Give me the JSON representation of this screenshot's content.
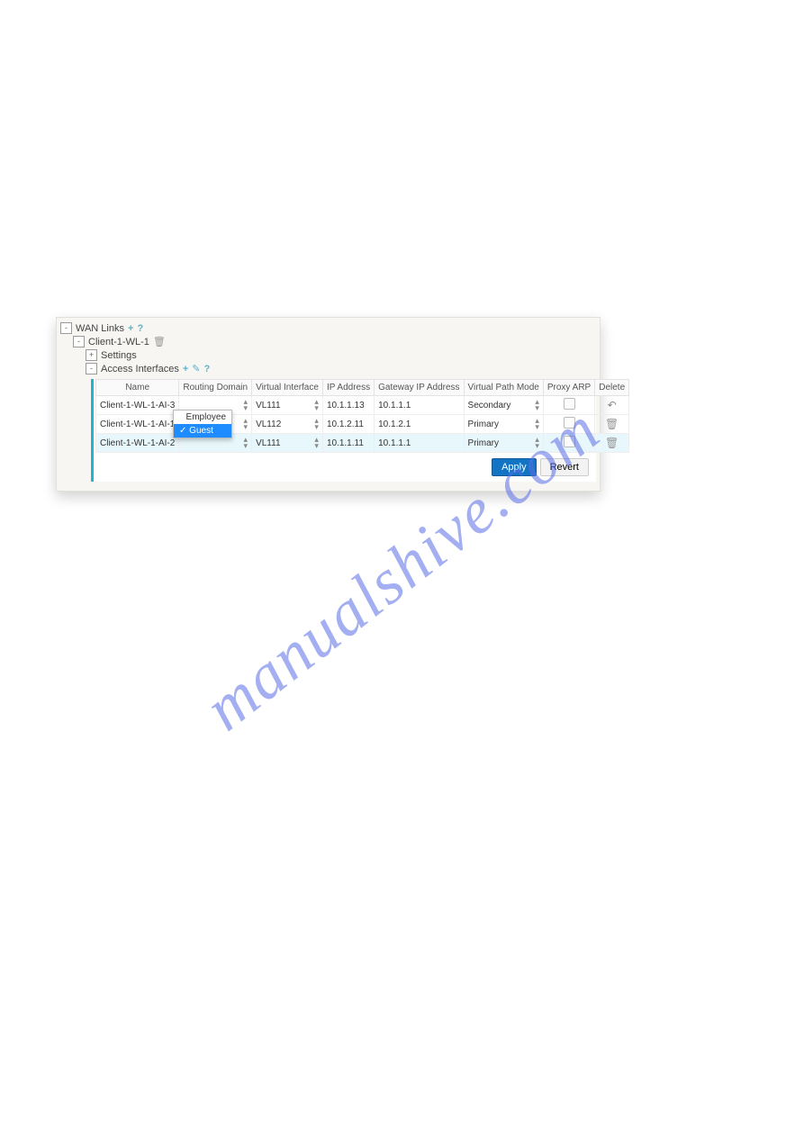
{
  "watermark": "manualshive.com",
  "tree": {
    "root": {
      "toggle": "-",
      "label": "WAN Links"
    },
    "root_icons": {
      "add": "+",
      "help": "?"
    },
    "child": {
      "toggle": "-",
      "label": "Client-1-WL-1"
    },
    "child_icon": "🗑",
    "settings": {
      "toggle": "+",
      "label": "Settings"
    },
    "access": {
      "toggle": "-",
      "label": "Access Interfaces"
    },
    "access_icons": {
      "add": "+",
      "edit": "✎",
      "help": "?"
    }
  },
  "table": {
    "headers": [
      "Name",
      "Routing Domain",
      "Virtual Interface",
      "IP Address",
      "Gateway IP Address",
      "Virtual Path Mode",
      "Proxy ARP",
      "Delete"
    ],
    "rows": [
      {
        "name": "Client-1-WL-1-AI-3",
        "vif": "VL111",
        "ip": "10.1.1.13",
        "gw": "10.1.1.1",
        "mode": "Secondary",
        "del": "undo"
      },
      {
        "name": "Client-1-WL-1-AI-1",
        "vif": "VL112",
        "ip": "10.1.2.11",
        "gw": "10.1.2.1",
        "mode": "Primary",
        "del": "trash"
      },
      {
        "name": "Client-1-WL-1-AI-2",
        "vif": "VL111",
        "ip": "10.1.1.11",
        "gw": "10.1.1.1",
        "mode": "Primary",
        "del": "trash",
        "selected": true
      }
    ]
  },
  "dropdown": {
    "opt1": "Employee",
    "opt2": "Guest",
    "check": "✓"
  },
  "buttons": {
    "apply": "Apply",
    "revert": "Revert"
  }
}
